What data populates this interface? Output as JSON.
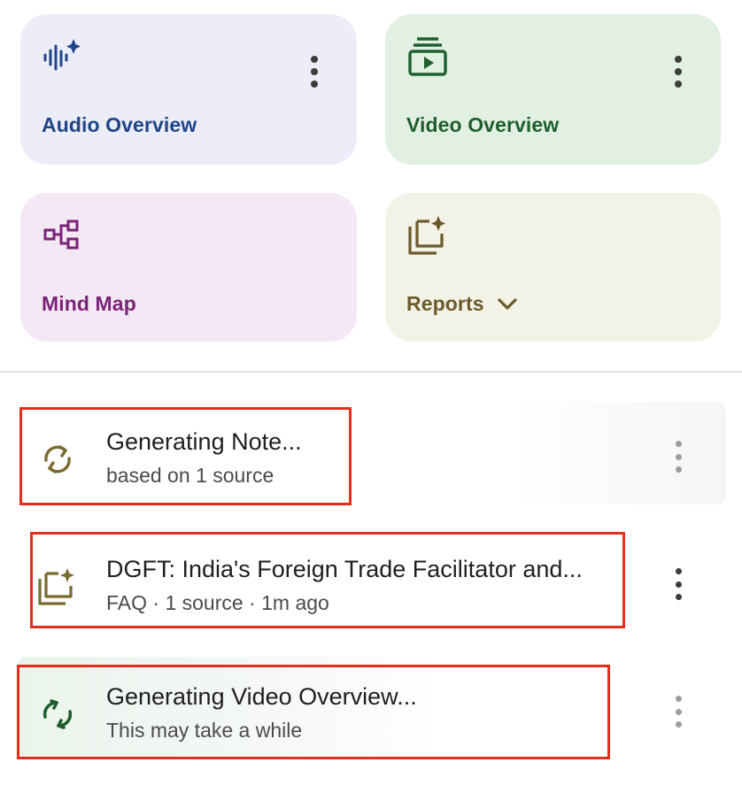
{
  "tiles": {
    "audio": {
      "label": "Audio Overview",
      "icon": "audio-waveform-sparkle-icon",
      "color": "#1e4588",
      "bg": "#ecedf8"
    },
    "video": {
      "label": "Video Overview",
      "icon": "video-play-stack-icon",
      "color": "#1f5f2c",
      "bg": "#e1f0e3"
    },
    "mindmap": {
      "label": "Mind Map",
      "icon": "mind-map-nodes-icon",
      "color": "#7b2378",
      "bg": "#f3e8f3"
    },
    "reports": {
      "label": "Reports",
      "icon": "reports-sparkle-icon",
      "color": "#6d5a2c",
      "bg": "#f2f2e6"
    }
  },
  "items": [
    {
      "title": "Generating Note...",
      "subtitle": "based on 1 source",
      "icon": "sync-icon",
      "icon_color": "#7a6a30"
    },
    {
      "title": "DGFT: India's Foreign Trade Facilitator and...",
      "subtitle": "FAQ · 1 source · 1m ago",
      "icon": "report-sparkle-icon",
      "icon_color": "#7a6a30"
    },
    {
      "title": "Generating Video Overview...",
      "subtitle": "This may take a while",
      "icon": "sync-icon",
      "icon_color": "#1f5f2c"
    }
  ],
  "highlight_color": "#e12f1c"
}
